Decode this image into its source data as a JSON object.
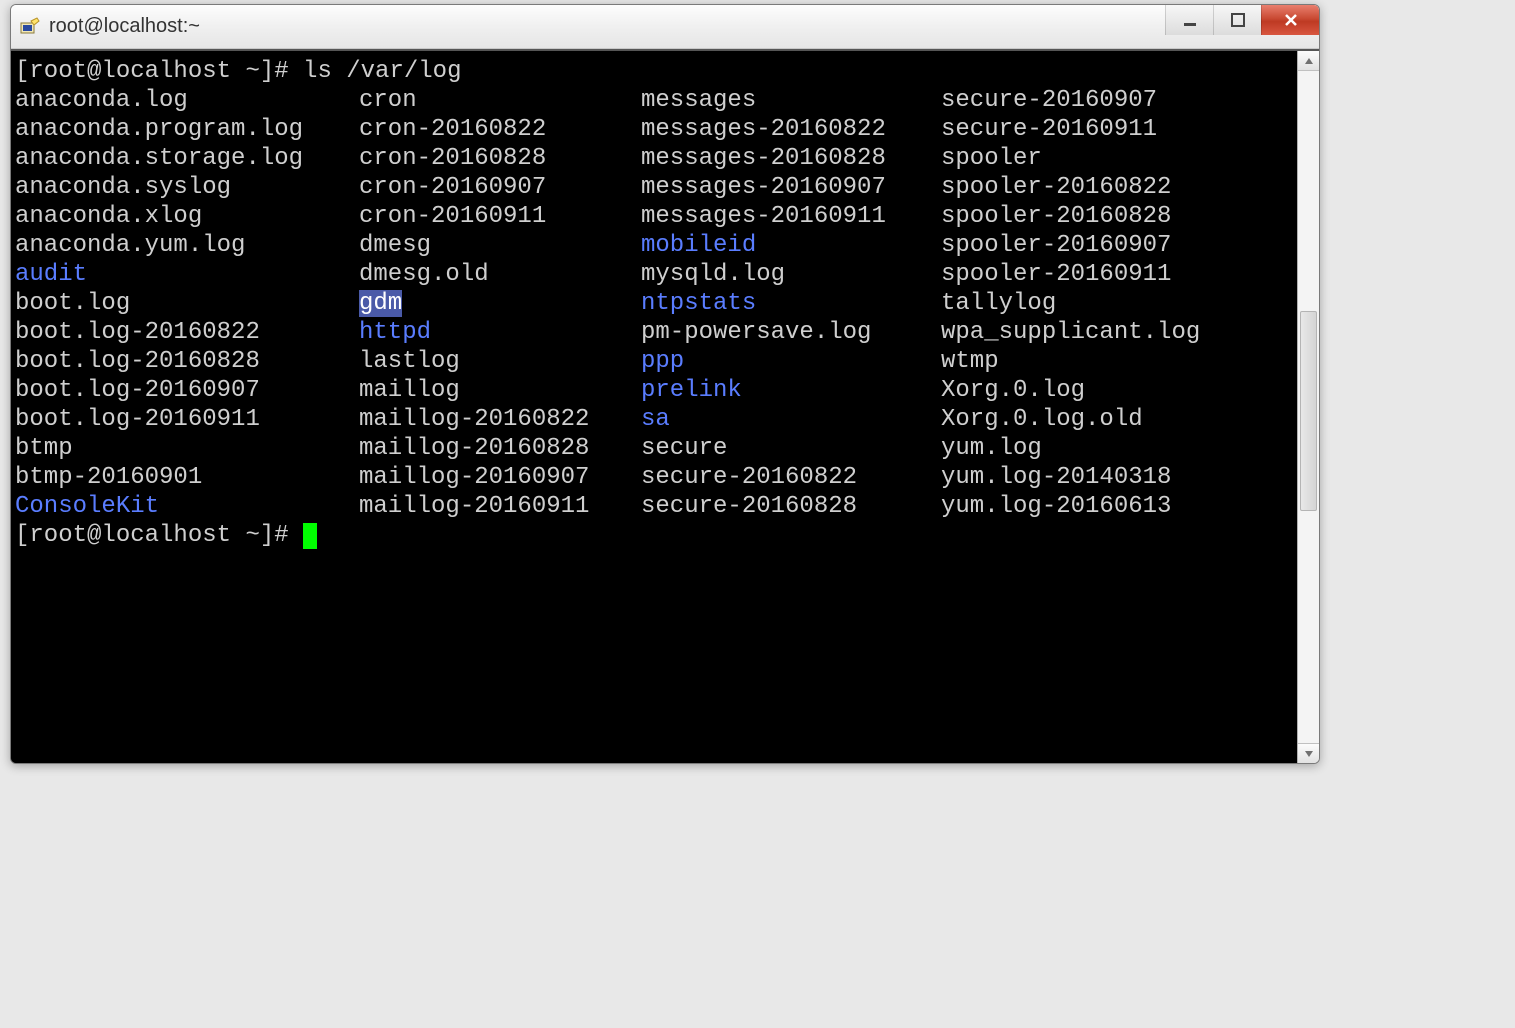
{
  "window": {
    "title": "root@localhost:~"
  },
  "terminal": {
    "prompt1": "[root@localhost ~]# ",
    "command": "ls /var/log",
    "prompt2": "[root@localhost ~]# ",
    "columns": [
      [
        {
          "name": "anaconda.log",
          "dir": false
        },
        {
          "name": "anaconda.program.log",
          "dir": false
        },
        {
          "name": "anaconda.storage.log",
          "dir": false
        },
        {
          "name": "anaconda.syslog",
          "dir": false
        },
        {
          "name": "anaconda.xlog",
          "dir": false
        },
        {
          "name": "anaconda.yum.log",
          "dir": false
        },
        {
          "name": "audit",
          "dir": true
        },
        {
          "name": "boot.log",
          "dir": false
        },
        {
          "name": "boot.log-20160822",
          "dir": false
        },
        {
          "name": "boot.log-20160828",
          "dir": false
        },
        {
          "name": "boot.log-20160907",
          "dir": false
        },
        {
          "name": "boot.log-20160911",
          "dir": false
        },
        {
          "name": "btmp",
          "dir": false
        },
        {
          "name": "btmp-20160901",
          "dir": false
        },
        {
          "name": "ConsoleKit",
          "dir": true
        }
      ],
      [
        {
          "name": "cron",
          "dir": false
        },
        {
          "name": "cron-20160822",
          "dir": false
        },
        {
          "name": "cron-20160828",
          "dir": false
        },
        {
          "name": "cron-20160907",
          "dir": false
        },
        {
          "name": "cron-20160911",
          "dir": false
        },
        {
          "name": "dmesg",
          "dir": false
        },
        {
          "name": "dmesg.old",
          "dir": false
        },
        {
          "name": "gdm",
          "dir": true,
          "selected": true
        },
        {
          "name": "httpd",
          "dir": true
        },
        {
          "name": "lastlog",
          "dir": false
        },
        {
          "name": "maillog",
          "dir": false
        },
        {
          "name": "maillog-20160822",
          "dir": false
        },
        {
          "name": "maillog-20160828",
          "dir": false
        },
        {
          "name": "maillog-20160907",
          "dir": false
        },
        {
          "name": "maillog-20160911",
          "dir": false
        }
      ],
      [
        {
          "name": "messages",
          "dir": false
        },
        {
          "name": "messages-20160822",
          "dir": false
        },
        {
          "name": "messages-20160828",
          "dir": false
        },
        {
          "name": "messages-20160907",
          "dir": false
        },
        {
          "name": "messages-20160911",
          "dir": false
        },
        {
          "name": "mobileid",
          "dir": true
        },
        {
          "name": "mysqld.log",
          "dir": false
        },
        {
          "name": "ntpstats",
          "dir": true
        },
        {
          "name": "pm-powersave.log",
          "dir": false
        },
        {
          "name": "ppp",
          "dir": true
        },
        {
          "name": "prelink",
          "dir": true
        },
        {
          "name": "sa",
          "dir": true
        },
        {
          "name": "secure",
          "dir": false
        },
        {
          "name": "secure-20160822",
          "dir": false
        },
        {
          "name": "secure-20160828",
          "dir": false
        }
      ],
      [
        {
          "name": "secure-20160907",
          "dir": false
        },
        {
          "name": "secure-20160911",
          "dir": false
        },
        {
          "name": "spooler",
          "dir": false
        },
        {
          "name": "spooler-20160822",
          "dir": false
        },
        {
          "name": "spooler-20160828",
          "dir": false
        },
        {
          "name": "spooler-20160907",
          "dir": false
        },
        {
          "name": "spooler-20160911",
          "dir": false
        },
        {
          "name": "tallylog",
          "dir": false
        },
        {
          "name": "wpa_supplicant.log",
          "dir": false
        },
        {
          "name": "wtmp",
          "dir": false
        },
        {
          "name": "Xorg.0.log",
          "dir": false
        },
        {
          "name": "Xorg.0.log.old",
          "dir": false
        },
        {
          "name": "yum.log",
          "dir": false
        },
        {
          "name": "yum.log-20140318",
          "dir": false
        },
        {
          "name": "yum.log-20160613",
          "dir": false
        }
      ]
    ]
  }
}
